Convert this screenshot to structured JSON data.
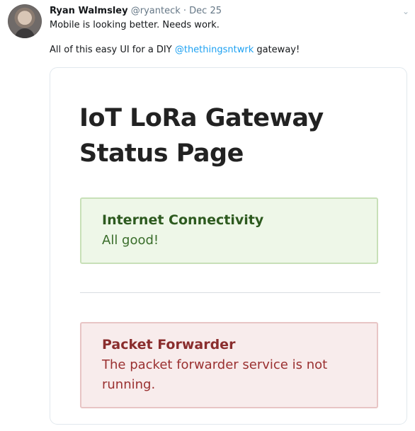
{
  "tweet": {
    "author": {
      "display_name": "Ryan Walmsley",
      "handle": "@ryanteck",
      "date": "Dec 25"
    },
    "text_line1": "Mobile is looking better. Needs work.",
    "text_line2_prefix": "All of this easy UI for a DIY ",
    "text_line2_mention": "@thethingsntwrk",
    "text_line2_suffix": " gateway!"
  },
  "card": {
    "page_title": "IoT LoRa Gateway Status Page",
    "statuses": [
      {
        "title": "Internet Connectivity",
        "message": "All good!",
        "state": "good",
        "accent": "#2d5a1f"
      },
      {
        "title": "Packet Forwarder",
        "message": "The packet forwarder service is not running.",
        "state": "error",
        "accent": "#8a2d2d"
      }
    ]
  },
  "icons": {
    "avatar": "avatar",
    "caret": "chevron-down-icon"
  }
}
